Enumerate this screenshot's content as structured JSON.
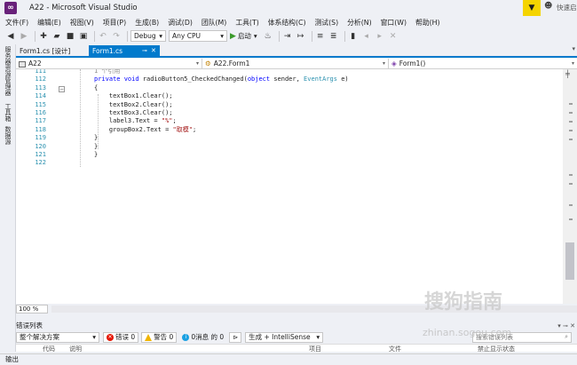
{
  "window": {
    "title": "A22 - Microsoft Visual Studio",
    "quick_launch": "快速启"
  },
  "menu": [
    "文件(F)",
    "编辑(E)",
    "视图(V)",
    "项目(P)",
    "生成(B)",
    "调试(D)",
    "团队(M)",
    "工具(T)",
    "体系结构(C)",
    "测试(S)",
    "分析(N)",
    "窗口(W)",
    "帮助(H)"
  ],
  "toolbar": {
    "config": "Debug",
    "platform": "Any CPU",
    "start_label": "启动"
  },
  "side_tabs": [
    "服务器资源管理器",
    "工具箱",
    "数据源"
  ],
  "doc_tabs": [
    {
      "label": "Form1.cs [设计]",
      "active": false
    },
    {
      "label": "Form1.cs",
      "active": true
    }
  ],
  "navbar": {
    "project": "A22",
    "class": "A22.Form1",
    "member": "Form1()"
  },
  "editor": {
    "lines": [
      {
        "num": "111",
        "ref": "1 个引用"
      },
      {
        "num": "112",
        "tokens": [
          [
            "kw",
            "private "
          ],
          [
            "kw",
            "void "
          ],
          [
            "",
            "radioButton5_CheckedChanged("
          ],
          [
            "kw",
            "object "
          ],
          [
            "",
            "sender, "
          ],
          [
            "ty",
            "EventArgs "
          ],
          [
            "",
            "e)"
          ]
        ]
      },
      {
        "num": "113",
        "tokens": [
          [
            "",
            "{"
          ]
        ]
      },
      {
        "num": "114",
        "tokens": [
          [
            "",
            "    textBox1.Clear();"
          ]
        ]
      },
      {
        "num": "115",
        "tokens": [
          [
            "",
            "    textBox2.Clear();"
          ]
        ]
      },
      {
        "num": "116",
        "tokens": [
          [
            "",
            "    textBox3.Clear();"
          ]
        ]
      },
      {
        "num": "117",
        "tokens": [
          [
            "",
            "    label3.Text = "
          ],
          [
            "st",
            "\"%\""
          ],
          [
            "",
            ";"
          ]
        ]
      },
      {
        "num": "118",
        "tokens": [
          [
            "",
            "    groupBox2.Text = "
          ],
          [
            "st",
            "\"取模\""
          ],
          [
            "",
            ";"
          ]
        ]
      },
      {
        "num": "119",
        "tokens": [
          [
            "",
            "}"
          ]
        ]
      },
      {
        "num": "120",
        "tokens": [
          [
            "",
            "}"
          ]
        ]
      },
      {
        "num": "121",
        "tokens": [
          [
            "",
            "}"
          ]
        ]
      },
      {
        "num": "122",
        "tokens": []
      }
    ]
  },
  "zoom": "100 %",
  "error_list": {
    "title": "错误列表",
    "scope": "整个解决方案",
    "errors": "错误 0",
    "warnings": "警告 0",
    "messages": "0消息 的 0",
    "build_filter": "生成 + IntelliSense",
    "search_placeholder": "搜索错误列表",
    "columns": [
      "代码",
      "说明",
      "项目",
      "文件",
      "禁止显示状态"
    ]
  },
  "output_label": "输出",
  "watermark": {
    "main": "搜狗指南",
    "sub": "zhinan.sogou.com"
  }
}
